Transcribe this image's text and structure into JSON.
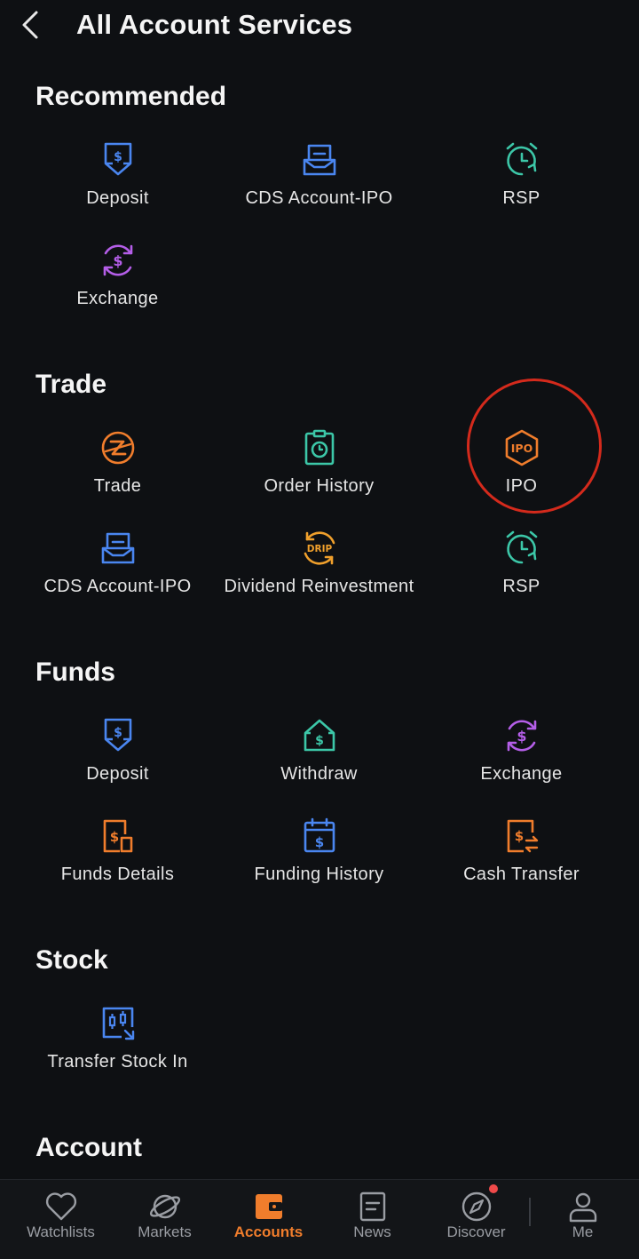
{
  "header": {
    "title": "All Account Services"
  },
  "colors": {
    "blue": "#4a86f0",
    "teal": "#3cc7a8",
    "purple": "#b45ee8",
    "orange": "#f07d2c",
    "gold": "#f0a02c",
    "highlight": "#d42a1c",
    "active_tab": "#f07d2c"
  },
  "sections": {
    "recommended": {
      "title": "Recommended",
      "items": [
        {
          "label": "Deposit",
          "icon": "deposit-icon"
        },
        {
          "label": "CDS Account-IPO",
          "icon": "cds-account-icon"
        },
        {
          "label": "RSP",
          "icon": "alarm-clock-icon"
        },
        {
          "label": "Exchange",
          "icon": "currency-exchange-icon"
        }
      ]
    },
    "trade": {
      "title": "Trade",
      "items": [
        {
          "label": "Trade",
          "icon": "trade-icon"
        },
        {
          "label": "Order History",
          "icon": "order-history-icon"
        },
        {
          "label": "IPO",
          "icon": "ipo-icon"
        },
        {
          "label": "CDS Account-IPO",
          "icon": "cds-account-icon"
        },
        {
          "label": "Dividend Reinvestment",
          "icon": "drip-icon",
          "icon_text": "DRIP"
        },
        {
          "label": "RSP",
          "icon": "alarm-clock-icon"
        }
      ]
    },
    "funds": {
      "title": "Funds",
      "items": [
        {
          "label": "Deposit",
          "icon": "deposit-icon"
        },
        {
          "label": "Withdraw",
          "icon": "withdraw-icon"
        },
        {
          "label": "Exchange",
          "icon": "currency-exchange-icon"
        },
        {
          "label": "Funds Details",
          "icon": "funds-details-icon"
        },
        {
          "label": "Funding History",
          "icon": "funding-history-icon"
        },
        {
          "label": "Cash Transfer",
          "icon": "cash-transfer-icon"
        }
      ]
    },
    "stock": {
      "title": "Stock",
      "items": [
        {
          "label": "Transfer Stock In",
          "icon": "transfer-stock-in-icon"
        }
      ]
    },
    "account": {
      "title": "Account"
    }
  },
  "ipo_icon_text": "IPO",
  "tabbar": {
    "tabs": [
      {
        "label": "Watchlists",
        "icon": "heart-icon"
      },
      {
        "label": "Markets",
        "icon": "planet-icon"
      },
      {
        "label": "Accounts",
        "icon": "wallet-icon",
        "active": true
      },
      {
        "label": "News",
        "icon": "news-icon"
      },
      {
        "label": "Discover",
        "icon": "compass-icon",
        "badge": true
      },
      {
        "label": "Me",
        "icon": "person-icon"
      }
    ]
  }
}
